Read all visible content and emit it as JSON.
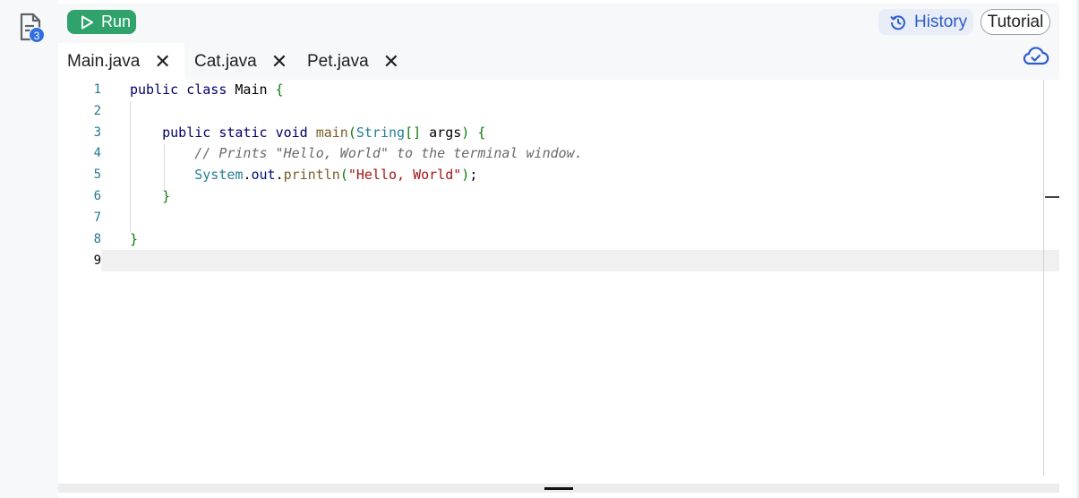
{
  "sidebar": {
    "files_badge": "3",
    "files_icon": "files-icon"
  },
  "toolbar": {
    "run_label": "Run",
    "history_label": "History",
    "tutorial_label": "Tutorial"
  },
  "tabs": [
    {
      "label": "Main.java",
      "close": "✕",
      "active": true
    },
    {
      "label": "Cat.java",
      "close": "✕",
      "active": false
    },
    {
      "label": "Pet.java",
      "close": "✕",
      "active": false
    }
  ],
  "editor": {
    "line_numbers": [
      "1",
      "2",
      "3",
      "4",
      "5",
      "6",
      "7",
      "8",
      "9"
    ],
    "lines": [
      "public class Main {",
      "",
      "    public static void main(String[] args) {",
      "        // Prints \"Hello, World\" to the terminal window.",
      "        System.out.println(\"Hello, World\");",
      "    }",
      "",
      "}",
      ""
    ],
    "active_line": 9
  },
  "colors": {
    "run": "#2fa36b",
    "history": "#2d5dc9",
    "badge": "#2f6fdf"
  }
}
